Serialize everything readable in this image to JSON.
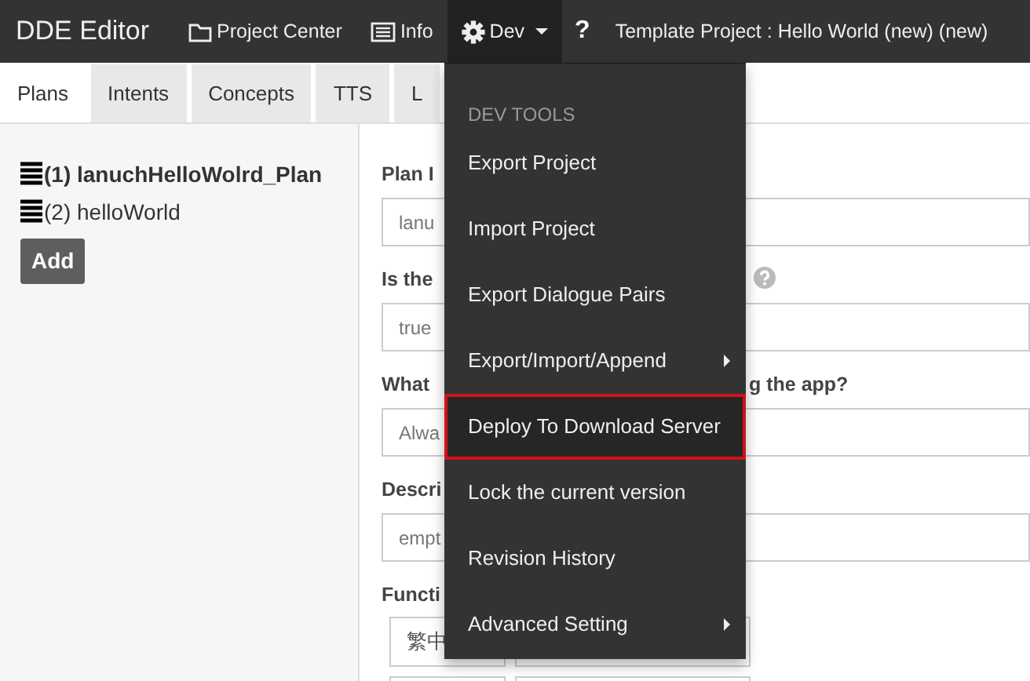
{
  "navbar": {
    "brand": "DDE Editor",
    "items": [
      {
        "kind": "folder",
        "label": "Project Center",
        "active": false
      },
      {
        "kind": "list",
        "label": "Info",
        "active": false
      },
      {
        "kind": "gear",
        "label": "Dev",
        "active": true,
        "dropdown": true
      }
    ],
    "help": "?",
    "project_title": "Template Project : Hello World (new) (new)"
  },
  "tabs": [
    {
      "label": "Plans",
      "selected": true
    },
    {
      "label": "Intents",
      "selected": false
    },
    {
      "label": "Concepts",
      "selected": false
    },
    {
      "label": "TTS",
      "selected": false
    },
    {
      "label": "L",
      "selected": false
    }
  ],
  "plans": {
    "items": [
      {
        "label": "(1) lanuchHelloWolrd_Plan",
        "selected": true
      },
      {
        "label": "(2) helloWorld",
        "selected": false
      }
    ],
    "add_button": "Add"
  },
  "form": {
    "fields": [
      {
        "label": "Plan I",
        "value": "lanu"
      },
      {
        "label": "Is the",
        "value": "true",
        "help": true
      },
      {
        "label": "What",
        "label_end": "g the app?",
        "value": "Alwa"
      },
      {
        "label": "Descri",
        "value": "empt"
      }
    ],
    "functions": {
      "label": "Functi",
      "first_cell": "繁中"
    }
  },
  "dev_menu": {
    "header": "DEV TOOLS",
    "items": [
      {
        "label": "Export Project",
        "kind": "item",
        "selected": false
      },
      {
        "label": "Import Project",
        "kind": "item",
        "selected": false
      },
      {
        "label": "Export Dialogue Pairs",
        "kind": "item",
        "selected": false
      },
      {
        "label": "Export/Import/Append",
        "kind": "submenu",
        "selected": false
      },
      {
        "label": "Deploy To Download Server",
        "kind": "item",
        "selected": true
      },
      {
        "label": "Lock the current version",
        "kind": "item",
        "selected": false
      },
      {
        "label": "Revision History",
        "kind": "item",
        "selected": false
      },
      {
        "label": "Advanced Setting",
        "kind": "submenu",
        "selected": false
      }
    ]
  }
}
